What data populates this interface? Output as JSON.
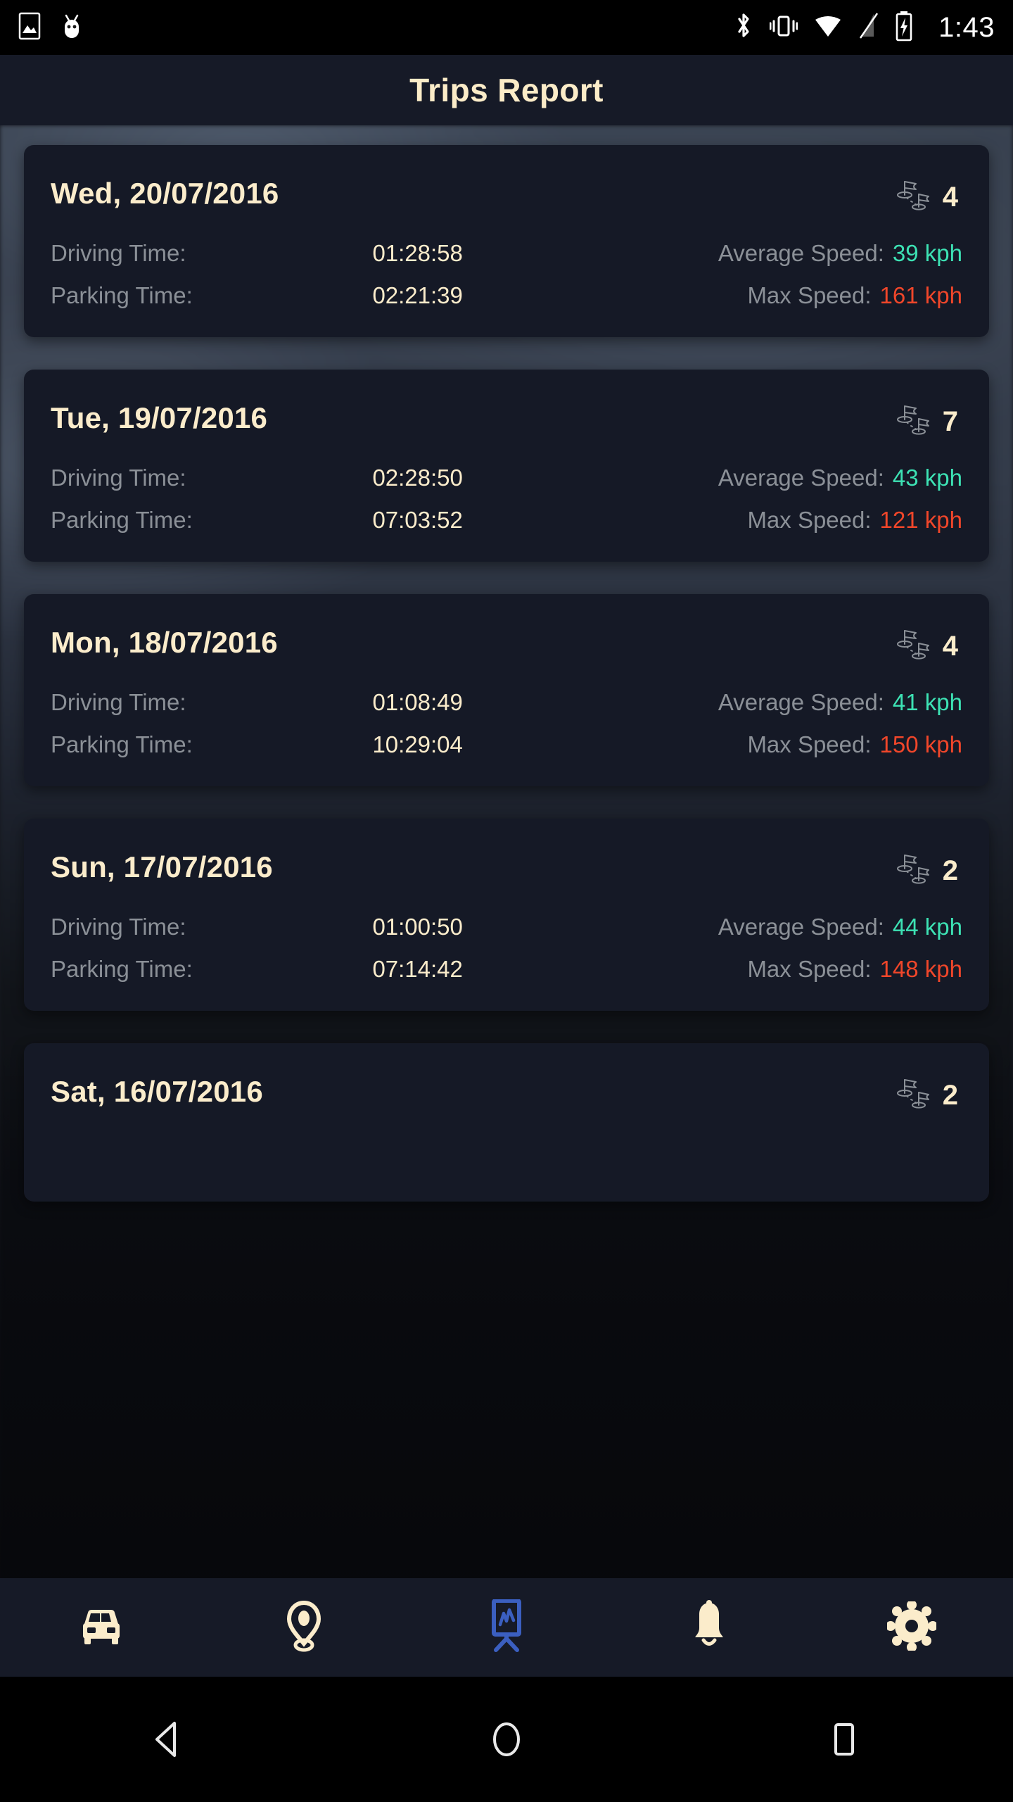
{
  "status_bar": {
    "icons_left": [
      "image-icon",
      "android-bug-icon"
    ],
    "icons_right": [
      "bluetooth-icon",
      "vibrate-icon",
      "wifi-icon",
      "signal-off-icon",
      "battery-charging-icon"
    ],
    "time": "1:43"
  },
  "header": {
    "title": "Trips Report"
  },
  "labels": {
    "driving_time": "Driving Time:",
    "parking_time": "Parking Time:",
    "average_speed": "Average Speed:",
    "max_speed": "Max Speed:"
  },
  "colors": {
    "accent_cream": "#fbeccb",
    "label_gray": "#8b9097",
    "avg_speed_green": "#3de2b4",
    "max_speed_red": "#f0462a",
    "active_nav_blue": "#3b5fc0",
    "card_bg": "#151926",
    "header_bg": "#161a27"
  },
  "trips": [
    {
      "date": "Wed, 20/07/2016",
      "trip_count": "4",
      "driving_time": "01:28:58",
      "parking_time": "02:21:39",
      "average_speed": "39 kph",
      "max_speed": "161 kph"
    },
    {
      "date": "Tue, 19/07/2016",
      "trip_count": "7",
      "driving_time": "02:28:50",
      "parking_time": "07:03:52",
      "average_speed": "43 kph",
      "max_speed": "121 kph"
    },
    {
      "date": "Mon, 18/07/2016",
      "trip_count": "4",
      "driving_time": "01:08:49",
      "parking_time": "10:29:04",
      "average_speed": "41 kph",
      "max_speed": "150 kph"
    },
    {
      "date": "Sun, 17/07/2016",
      "trip_count": "2",
      "driving_time": "01:00:50",
      "parking_time": "07:14:42",
      "average_speed": "44 kph",
      "max_speed": "148 kph"
    },
    {
      "date": "Sat, 16/07/2016",
      "trip_count": "2",
      "driving_time": "",
      "parking_time": "",
      "average_speed": "",
      "max_speed": ""
    }
  ],
  "bottom_nav": [
    {
      "name": "car-icon",
      "label": "Vehicle",
      "active": false
    },
    {
      "name": "pin-icon",
      "label": "Location",
      "active": false
    },
    {
      "name": "chart-board-icon",
      "label": "Reports",
      "active": true
    },
    {
      "name": "bell-icon",
      "label": "Alerts",
      "active": false
    },
    {
      "name": "gear-icon",
      "label": "Settings",
      "active": false
    }
  ],
  "android_nav": [
    {
      "name": "back-button",
      "label": "Back"
    },
    {
      "name": "home-button",
      "label": "Home"
    },
    {
      "name": "recents-button",
      "label": "Recents"
    }
  ]
}
